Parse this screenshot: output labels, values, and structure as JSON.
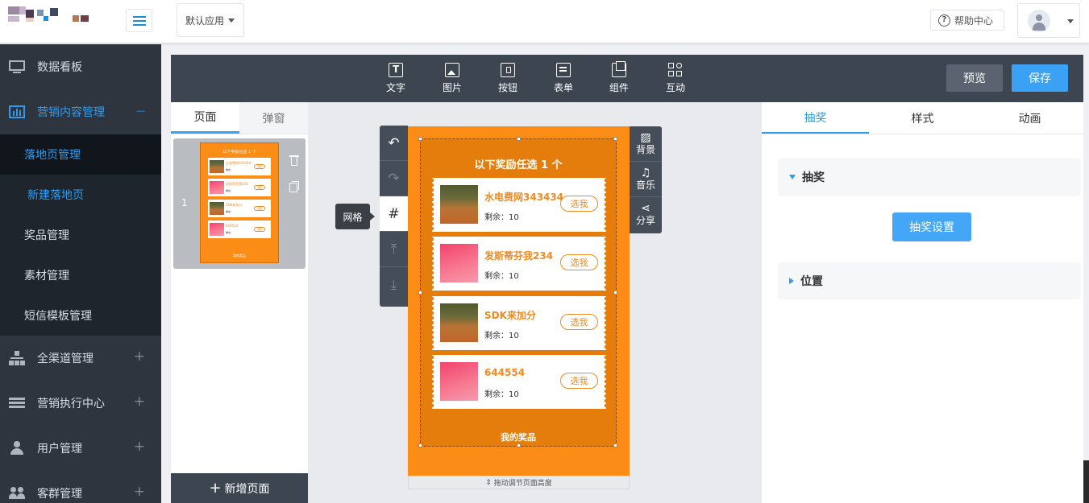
{
  "header": {
    "app_select": "默认应用",
    "help": "帮助中心"
  },
  "sidebar": {
    "dashboard": "数据看板",
    "marketing": "营销内容管理",
    "marketing_sign": "—",
    "sub": [
      "落地页管理",
      "新建落地页",
      "奖品管理",
      "素材管理",
      "短信模板管理"
    ],
    "channels": "全渠道管理",
    "execution": "营销执行中心",
    "users": "用户管理",
    "groups": "客群管理",
    "plus": "+"
  },
  "toolbar": {
    "tools": [
      "文字",
      "图片",
      "按钮",
      "表单",
      "组件",
      "互动"
    ],
    "preview": "预览",
    "save": "保存"
  },
  "left_panel": {
    "tabs": [
      "页面",
      "弹窗"
    ],
    "page_number": "1",
    "add_page": "新增页面"
  },
  "canvas": {
    "tooltip": "网格",
    "title": "以下奖励任选 1 个",
    "remaining_label": "剩余：",
    "choose": "选我",
    "prizes": [
      {
        "name": "水电费网343434",
        "remaining": "10",
        "image": "tree"
      },
      {
        "name": "发斯蒂芬我234",
        "remaining": "10",
        "image": "pink"
      },
      {
        "name": "SDK来加分",
        "remaining": "10",
        "image": "tree"
      },
      {
        "name": "644554",
        "remaining": "10",
        "image": "pink"
      }
    ],
    "my_prizes": "我的奖品",
    "drag_hint": "拖动调节页面高度",
    "side_tools": [
      "背景",
      "音乐",
      "分享"
    ]
  },
  "right_panel": {
    "tabs": [
      "抽奖",
      "样式",
      "动画"
    ],
    "section_lottery": "抽奖",
    "lottery_settings": "抽奖设置",
    "section_position": "位置"
  },
  "colors": {
    "accent": "#2d9cf0",
    "sidebar": "#2e353f",
    "phone_bg": "#fb8c16",
    "prize_text": "#f08a21"
  }
}
